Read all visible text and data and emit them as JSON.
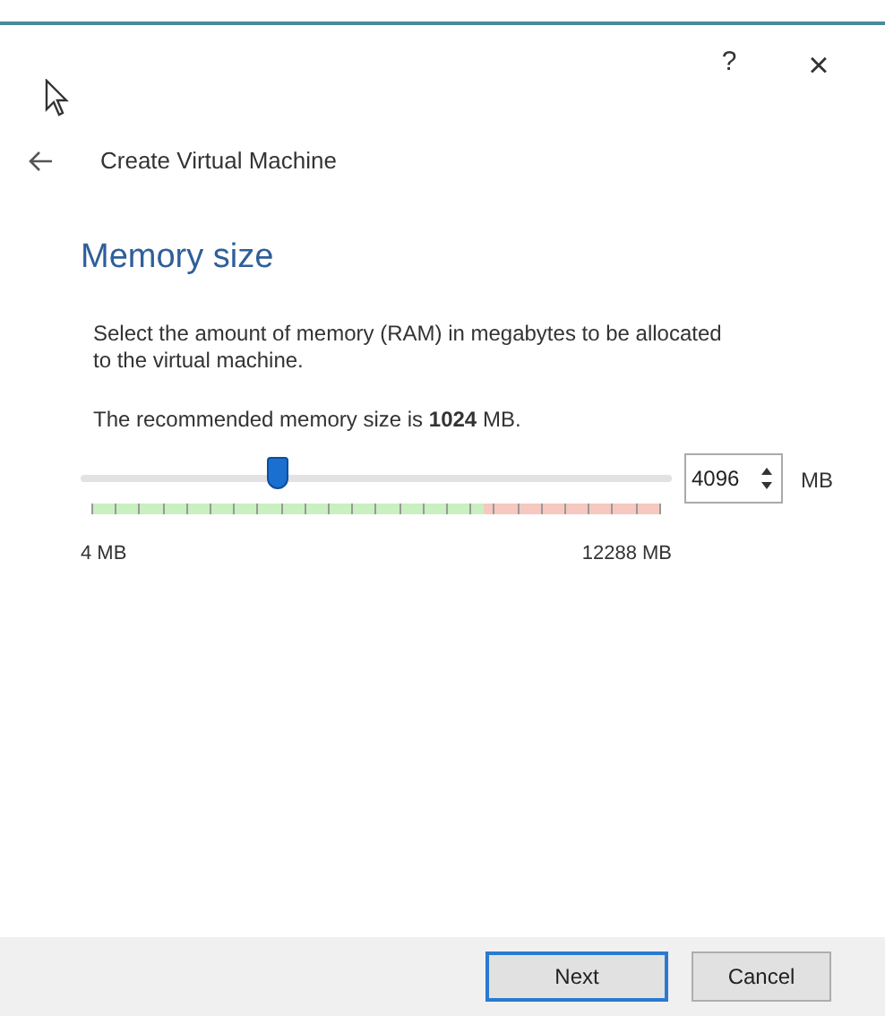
{
  "title_bar": {
    "help": "?",
    "close": "×"
  },
  "header": {
    "title": "Create Virtual Machine"
  },
  "page": {
    "heading": "Memory size",
    "description": "Select the amount of memory (RAM) in megabytes to be allocated to the virtual machine.",
    "recommendation": "The recommended memory size is **1024** MB.",
    "slider": {
      "level": 0.333,
      "min_label": "4 MB",
      "max_label": "12288 MB"
    },
    "spinbox": {
      "value": "4096",
      "unit": "MB"
    }
  },
  "buttons": [
    {
      "label": "Next",
      "selected": true
    },
    {
      "label": "Cancel",
      "selected": false
    }
  ]
}
